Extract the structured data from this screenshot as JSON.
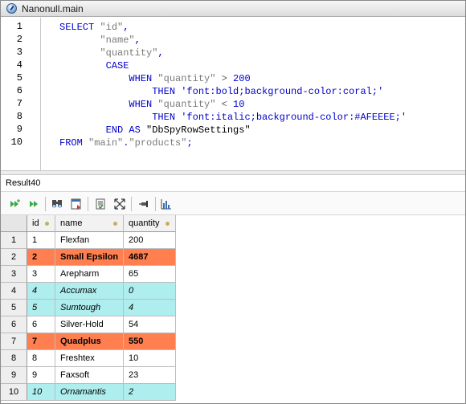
{
  "window": {
    "title": "Nanonull.main"
  },
  "editor": {
    "line_numbers": [
      "1",
      "2",
      "3",
      "4",
      "5",
      "6",
      "7",
      "8",
      "9",
      "10"
    ],
    "lines": [
      [
        {
          "t": "SELECT ",
          "c": "kw"
        },
        {
          "t": "\"id\"",
          "c": "str"
        },
        {
          "t": ",",
          "c": "kw"
        }
      ],
      [
        {
          "t": "       ",
          "c": ""
        },
        {
          "t": "\"name\"",
          "c": "str"
        },
        {
          "t": ",",
          "c": "kw"
        }
      ],
      [
        {
          "t": "       ",
          "c": ""
        },
        {
          "t": "\"quantity\"",
          "c": "str"
        },
        {
          "t": ",",
          "c": "kw"
        }
      ],
      [
        {
          "t": "        CASE",
          "c": "kw"
        }
      ],
      [
        {
          "t": "            WHEN ",
          "c": "kw"
        },
        {
          "t": "\"quantity\"",
          "c": "str"
        },
        {
          "t": " > ",
          "c": "op"
        },
        {
          "t": "200",
          "c": "lit"
        }
      ],
      [
        {
          "t": "                THEN ",
          "c": "kw"
        },
        {
          "t": "'font:bold;background-color:coral;'",
          "c": "lit"
        }
      ],
      [
        {
          "t": "            WHEN ",
          "c": "kw"
        },
        {
          "t": "\"quantity\"",
          "c": "str"
        },
        {
          "t": " < ",
          "c": "op"
        },
        {
          "t": "10",
          "c": "lit"
        }
      ],
      [
        {
          "t": "                THEN ",
          "c": "kw"
        },
        {
          "t": "'font:italic;background-color:#AFEEEE;'",
          "c": "lit"
        }
      ],
      [
        {
          "t": "        END AS ",
          "c": "kw"
        },
        {
          "t": "\"DbSpyRowSettings\"",
          "c": ""
        }
      ],
      [
        {
          "t": "FROM ",
          "c": "kw"
        },
        {
          "t": "\"main\"",
          "c": "str"
        },
        {
          "t": ".",
          "c": "kw"
        },
        {
          "t": "\"products\"",
          "c": "str"
        },
        {
          "t": ";",
          "c": "kw"
        }
      ]
    ]
  },
  "result": {
    "title": "Result40",
    "toolbar_icons": [
      "execute-next-icon",
      "execute-all-icon",
      "find-icon",
      "export-icon",
      "copy-icon",
      "auto-size-icon",
      "pin-icon",
      "chart-icon"
    ],
    "columns": [
      "id",
      "name",
      "quantity"
    ],
    "rows": [
      {
        "num": "1",
        "id": "1",
        "name": "Flexfan",
        "quantity": "200",
        "style": "plain"
      },
      {
        "num": "2",
        "id": "2",
        "name": "Small Epsilon",
        "quantity": "4687",
        "style": "bold"
      },
      {
        "num": "3",
        "id": "3",
        "name": "Arepharm",
        "quantity": "65",
        "style": "plain"
      },
      {
        "num": "4",
        "id": "4",
        "name": "Accumax",
        "quantity": "0",
        "style": "italic"
      },
      {
        "num": "5",
        "id": "5",
        "name": "Sumtough",
        "quantity": "4",
        "style": "italic"
      },
      {
        "num": "6",
        "id": "6",
        "name": "Silver-Hold",
        "quantity": "54",
        "style": "plain"
      },
      {
        "num": "7",
        "id": "7",
        "name": "Quadplus",
        "quantity": "550",
        "style": "bold"
      },
      {
        "num": "8",
        "id": "8",
        "name": "Freshtex",
        "quantity": "10",
        "style": "plain"
      },
      {
        "num": "9",
        "id": "9",
        "name": "Faxsoft",
        "quantity": "23",
        "style": "plain"
      },
      {
        "num": "10",
        "id": "10",
        "name": "Ornamantis",
        "quantity": "2",
        "style": "italic"
      }
    ]
  },
  "colors": {
    "coral": "#ff7f50",
    "paleturquoise": "#afeeee",
    "keyword": "#0000cc",
    "string": "#7a7a7a"
  }
}
